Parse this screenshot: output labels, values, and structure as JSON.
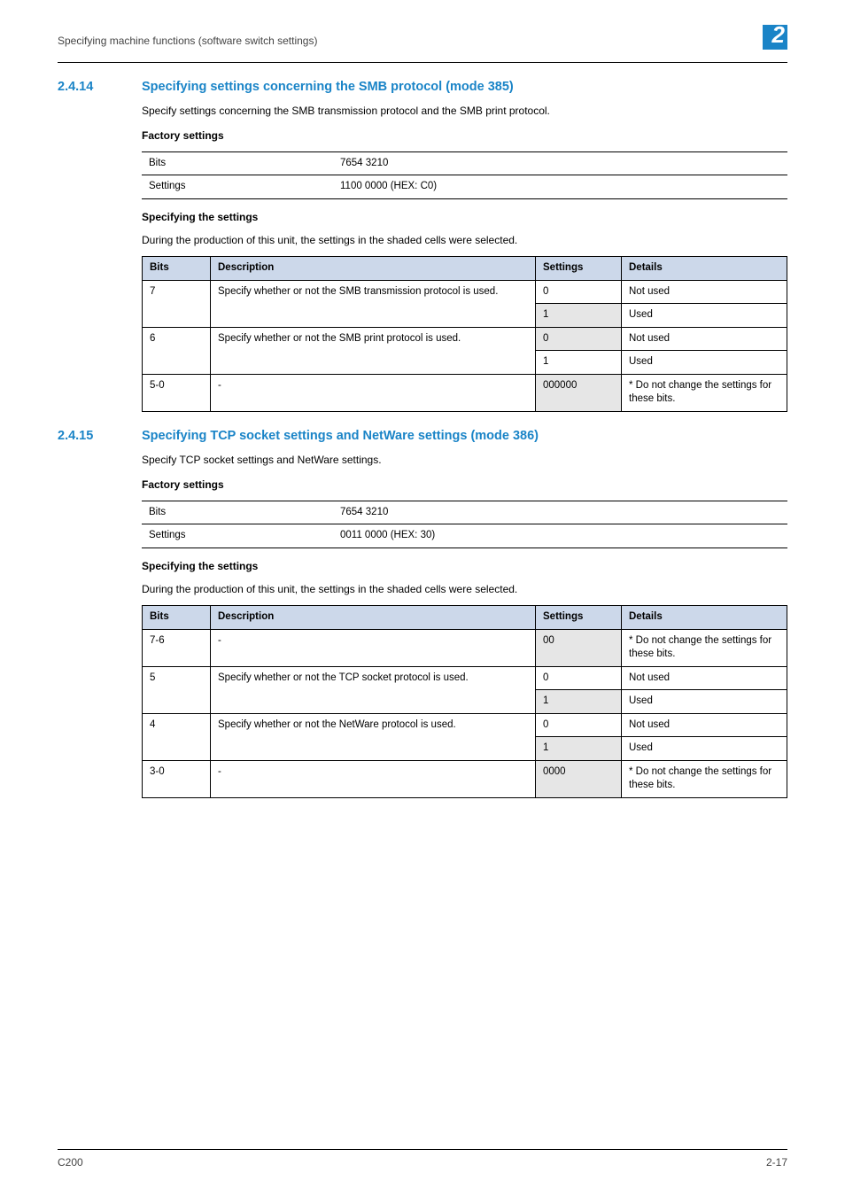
{
  "header": {
    "running_title": "Specifying machine functions (software switch settings)",
    "chapter_number": "2"
  },
  "sections": [
    {
      "number": "2.4.14",
      "title": "Specifying settings concerning the SMB protocol (mode 385)",
      "intro": "Specify settings concerning the SMB transmission protocol and the SMB print protocol.",
      "factory_settings_label": "Factory settings",
      "factory_table": {
        "bits_label": "Bits",
        "bits_value": "7654 3210",
        "settings_label": "Settings",
        "settings_value": "1100 0000 (HEX: C0)"
      },
      "spec_heading": "Specifying the settings",
      "spec_intro": "During the production of this unit, the settings in the shaded cells were selected.",
      "table": {
        "headers": {
          "bits": "Bits",
          "desc": "Description",
          "settings": "Settings",
          "details": "Details"
        },
        "rows": [
          {
            "bits": "7",
            "desc": "Specify whether or not the SMB transmission protocol is used.",
            "settings": [
              "0",
              "1"
            ],
            "details": [
              "Not used",
              "Used"
            ],
            "shaded_index": 1,
            "rowspan_desc": 2
          },
          {
            "bits": "6",
            "desc": "Specify whether or not the SMB print protocol is used.",
            "settings": [
              "0",
              "1"
            ],
            "details": [
              "Not used",
              "Used"
            ],
            "shaded_index": 0,
            "rowspan_desc": 2
          },
          {
            "bits": "5-0",
            "desc": "-",
            "settings": [
              "000000"
            ],
            "details": [
              "* Do not change the settings for these bits."
            ],
            "shaded_index": 0
          }
        ]
      }
    },
    {
      "number": "2.4.15",
      "title": "Specifying TCP socket settings and NetWare settings (mode 386)",
      "intro": "Specify TCP socket settings and NetWare settings.",
      "factory_settings_label": "Factory settings",
      "factory_table": {
        "bits_label": "Bits",
        "bits_value": "7654 3210",
        "settings_label": "Settings",
        "settings_value": "0011 0000 (HEX: 30)"
      },
      "spec_heading": "Specifying the settings",
      "spec_intro": "During the production of this unit, the settings in the shaded cells were selected.",
      "table": {
        "headers": {
          "bits": "Bits",
          "desc": "Description",
          "settings": "Settings",
          "details": "Details"
        },
        "rows": [
          {
            "bits": "7-6",
            "desc": "-",
            "settings": [
              "00"
            ],
            "details": [
              "* Do not change the settings for these bits."
            ],
            "shaded_index": 0
          },
          {
            "bits": "5",
            "desc": "Specify whether or not the TCP socket protocol is used.",
            "settings": [
              "0",
              "1"
            ],
            "details": [
              "Not used",
              "Used"
            ],
            "shaded_index": 1,
            "rowspan_desc": 2
          },
          {
            "bits": "4",
            "desc": "Specify whether or not the NetWare protocol is used.",
            "settings": [
              "0",
              "1"
            ],
            "details": [
              "Not used",
              "Used"
            ],
            "shaded_index": 1,
            "rowspan_desc": 2
          },
          {
            "bits": "3-0",
            "desc": "-",
            "settings": [
              "0000"
            ],
            "details": [
              "* Do not change the settings for these bits."
            ],
            "shaded_index": 0
          }
        ]
      }
    }
  ],
  "footer": {
    "left": "C200",
    "right": "2-17"
  }
}
